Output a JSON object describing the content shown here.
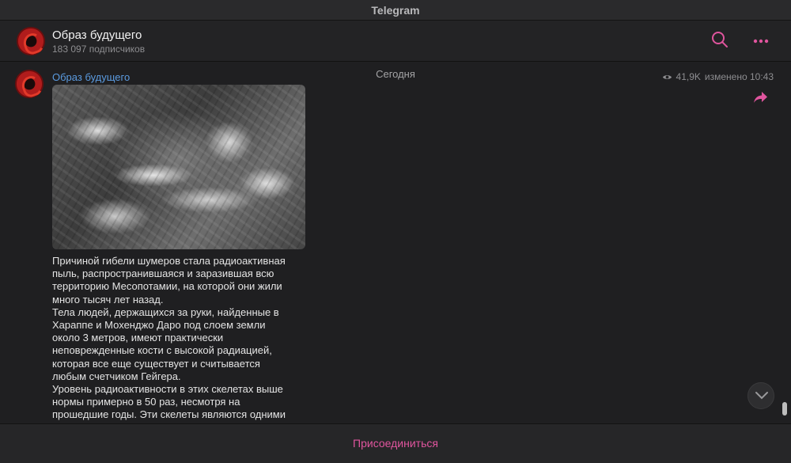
{
  "window": {
    "title": "Telegram"
  },
  "header": {
    "channel_name": "Образ будущего",
    "subscribers": "183 097 подписчиков",
    "icons": {
      "search": "search-icon",
      "more": "more-dots-icon",
      "avatar": "channel-avatar"
    }
  },
  "feed": {
    "date_separator": "Сегодня",
    "message": {
      "author": "Образ будущего",
      "views": "41,9K",
      "edited_time": "изменено 10:43",
      "lines": [
        "Причиной гибели шумеров стала радиоактивная",
        "пыль, распространившаяся и заразившая всю",
        "территорию Месопотамии, на которой они жили",
        "много тысяч лет назад.",
        "Тела людей, держащихся за руки, найденные в",
        "Хараппе и Мохенджо Даро под слоем земли",
        "около 3 метров, имеют практически",
        "неповрежденные кости с высокой радиацией,",
        "которая все еще существует и считывается",
        "любым счетчиком Гейгера.",
        "Уровень радиоактивности в этих скелетах выше",
        "нормы примерно в 50 раз, несмотря на",
        "прошедшие годы. Эти скелеты являются одними"
      ]
    }
  },
  "footer": {
    "join_label": "Присоединиться"
  },
  "colors": {
    "accent": "#e0559e",
    "link": "#5b9be0",
    "background": "#1f1f21"
  }
}
